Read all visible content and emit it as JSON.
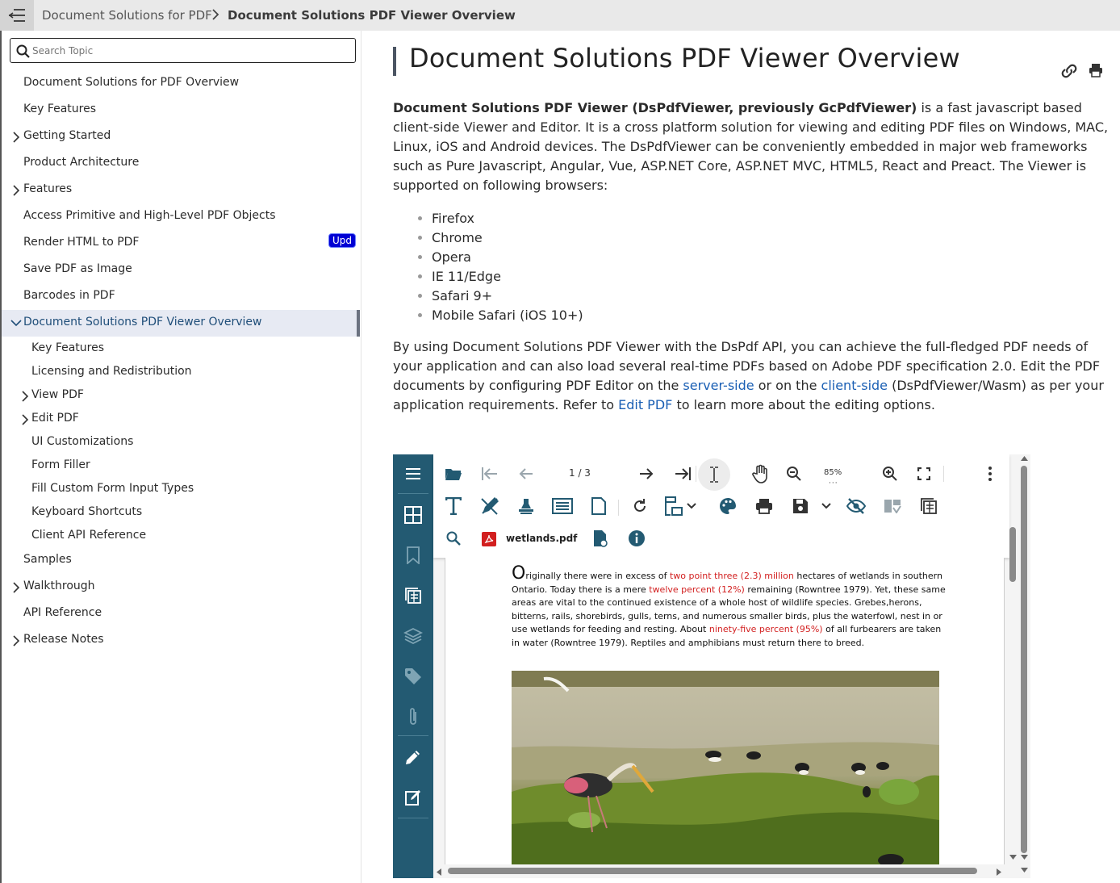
{
  "header": {
    "breadcrumb": [
      "Document Solutions for PDF",
      "Document Solutions PDF Viewer Overview"
    ]
  },
  "sidebar": {
    "search_placeholder": "Search Topic",
    "items": [
      {
        "label": "Document Solutions for PDF Overview"
      },
      {
        "label": "Key Features"
      },
      {
        "label": "Getting Started"
      },
      {
        "label": "Product Architecture"
      },
      {
        "label": "Features"
      },
      {
        "label": "Access Primitive and High-Level PDF Objects"
      },
      {
        "label": "Render HTML to PDF",
        "badge": "Upd"
      },
      {
        "label": "Save PDF as Image"
      },
      {
        "label": "Barcodes in PDF"
      },
      {
        "label": "Document Solutions PDF Viewer Overview"
      },
      {
        "label": "Key Features"
      },
      {
        "label": "Licensing and Redistribution"
      },
      {
        "label": "View PDF"
      },
      {
        "label": "Edit PDF"
      },
      {
        "label": "UI Customizations"
      },
      {
        "label": "Form Filler"
      },
      {
        "label": "Fill Custom Form Input Types"
      },
      {
        "label": "Keyboard Shortcuts"
      },
      {
        "label": "Client API Reference"
      },
      {
        "label": "Samples"
      },
      {
        "label": "Walkthrough"
      },
      {
        "label": "API Reference"
      },
      {
        "label": "Release Notes"
      }
    ]
  },
  "main": {
    "title": "Document Solutions PDF Viewer Overview",
    "intro_bold": "Document Solutions PDF Viewer (DsPdfViewer, previously GcPdfViewer)",
    "intro_rest": " is a fast javascript based client-side Viewer and Editor. It is a cross platform solution for viewing and editing PDF files on Windows, MAC, Linux, iOS and Android devices. The DsPdfViewer can be conveniently embedded in major web frameworks such as Pure Javascript, Angular, Vue, ASP.NET Core, ASP.NET MVC, HTML5, React and Preact. The Viewer is supported on following browsers:",
    "browsers": [
      "Firefox",
      "Chrome",
      "Opera",
      "IE 11/Edge",
      "Safari 9+",
      "Mobile Safari (iOS 10+)"
    ],
    "p2_a": "By using Document Solutions PDF Viewer with the DsPdf API, you can achieve the full-fledged PDF needs of your application and can also load several real-time PDFs based on Adobe PDF specification 2.0. Edit the PDF documents by configuring PDF Editor on the ",
    "p2_link1": "server-side",
    "p2_b": " or on the ",
    "p2_link2": "client-side",
    "p2_c": " (DsPdfViewer/Wasm) as per your application requirements. Refer to ",
    "p2_link3": "Edit PDF",
    "p2_d": " to learn more about the editing options."
  },
  "viewer": {
    "page_indicator": "1 / 3",
    "zoom": "85%",
    "filename": "wetlands.pdf",
    "doc": {
      "cap": "O",
      "t1": "riginally there were in excess of ",
      "r1": "two point three (2.3) million",
      "t2": " hectares of wetlands in southern Ontario. Today there is a mere ",
      "r2": "twelve percent (12%)",
      "t3": " remaining (Rowntree 1979). Yet, these same areas are vital to the continued existence of a whole host of wildlife species. Grebes,herons, bitterns, rails, shorebirds, gulls, terns, and numerous smaller birds, plus the waterfowl, nest in or use wetlands for feeding and resting. About ",
      "r3": "ninety-five percent (95%)",
      "t4": " of all furbearers are taken in water (Rowntree 1979). Reptiles and amphibians must return there to breed."
    }
  },
  "colors": {
    "viewer_sidebar": "#235a72",
    "link": "#1a5fb4",
    "badge": "#0000d4",
    "doc_highlight": "#d21f1f"
  }
}
